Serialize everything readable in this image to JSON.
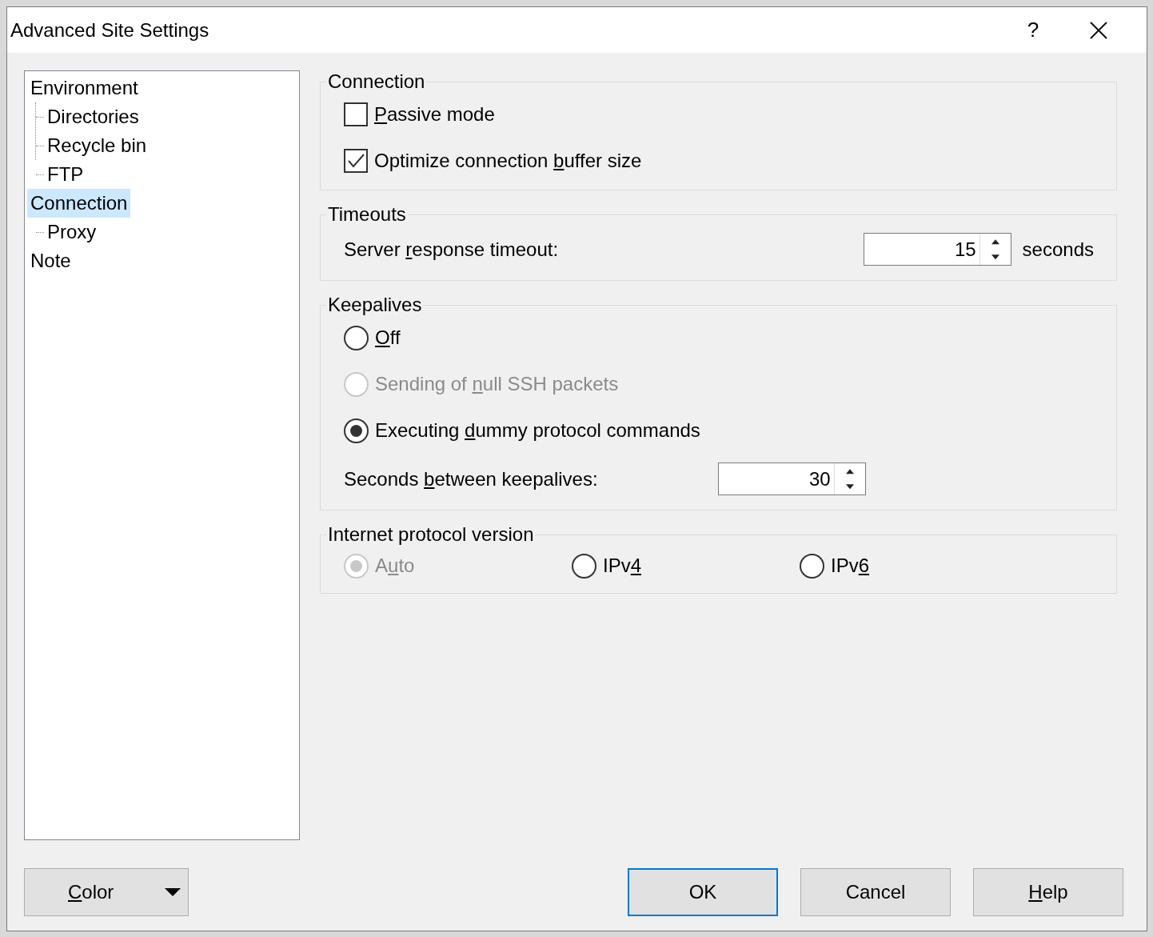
{
  "window": {
    "title": "Advanced Site Settings",
    "help": "?"
  },
  "tree": [
    {
      "label": "Environment",
      "selected": false,
      "children": [
        {
          "label": "Directories",
          "selected": false
        },
        {
          "label": "Recycle bin",
          "selected": false
        },
        {
          "label": "FTP",
          "selected": false
        }
      ]
    },
    {
      "label": "Connection",
      "selected": true,
      "children": [
        {
          "label": "Proxy",
          "selected": false
        }
      ]
    },
    {
      "label": "Note",
      "selected": false
    }
  ],
  "groups": [
    {
      "title": "Connection",
      "kind": "stack",
      "items": [
        {
          "kind": "checkbox",
          "label": {
            "key": "P",
            "post": "assive mode"
          },
          "checked": false
        },
        {
          "kind": "checkbox",
          "label": {
            "pre": "Optimize connection ",
            "key": "b",
            "post": "uffer size"
          },
          "checked": true
        }
      ]
    },
    {
      "title": "Timeouts",
      "kind": "stack",
      "items": [
        {
          "kind": "spin",
          "label": {
            "pre": "Server ",
            "key": "r",
            "post": "esponse timeout:"
          },
          "value": "15",
          "unit": "seconds"
        }
      ]
    },
    {
      "title": "Keepalives",
      "kind": "stack",
      "items": [
        {
          "kind": "radio",
          "label": {
            "key": "O",
            "post": "ff"
          },
          "selected": false,
          "disabled": false
        },
        {
          "kind": "radio",
          "label": {
            "pre": "Sending of ",
            "key": "n",
            "post": "ull SSH packets"
          },
          "selected": false,
          "disabled": true
        },
        {
          "kind": "radio",
          "label": {
            "pre": "Executing ",
            "key": "d",
            "post": "ummy protocol commands"
          },
          "selected": true,
          "disabled": false
        },
        {
          "kind": "spin",
          "label": {
            "pre": "Seconds ",
            "key": "b",
            "post": "etween keepalives:"
          },
          "value": "30"
        }
      ]
    },
    {
      "title": "Internet protocol version",
      "kind": "row",
      "items": [
        {
          "kind": "radio",
          "label": {
            "pre": "A",
            "key": "u",
            "post": "to"
          },
          "selected": true,
          "disabled": true
        },
        {
          "kind": "radio",
          "label": {
            "pre": "IPv",
            "key": "4"
          },
          "selected": false,
          "disabled": false
        },
        {
          "kind": "radio",
          "label": {
            "pre": "IPv",
            "key": "6"
          },
          "selected": false,
          "disabled": false
        }
      ]
    }
  ],
  "buttons": [
    {
      "kind": "dropdown",
      "label": {
        "key": "C",
        "post": "olor"
      },
      "default": false
    },
    {
      "kind": "push",
      "label": {
        "pre": "OK"
      },
      "default": true
    },
    {
      "kind": "push",
      "label": {
        "pre": "Cancel"
      },
      "default": false
    },
    {
      "kind": "push",
      "label": {
        "key": "H",
        "post": "elp"
      },
      "default": false
    }
  ]
}
